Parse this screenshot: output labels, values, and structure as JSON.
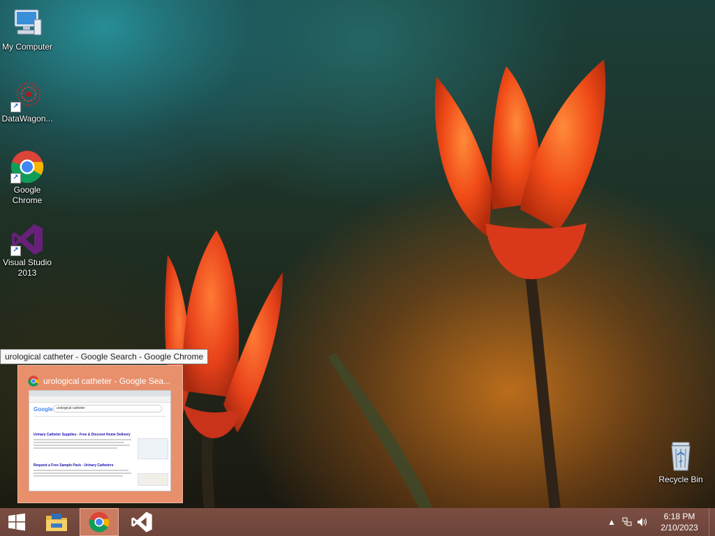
{
  "desktop_icons": [
    {
      "name": "my-computer",
      "label": "My Computer"
    },
    {
      "name": "datawagon",
      "label": "DataWagon..."
    },
    {
      "name": "google-chrome",
      "label": "Google Chrome"
    },
    {
      "name": "visual-studio",
      "label": "Visual Studio 2013"
    },
    {
      "name": "recycle-bin",
      "label": "Recycle Bin"
    }
  ],
  "tooltip": {
    "text": "urological catheter - Google Search - Google Chrome"
  },
  "thumbnail": {
    "title": "urological catheter - Google Sea...",
    "page_logo": "Google",
    "search_text": "urological catheter",
    "result_1_title": "Urinary Catheter Supplies - Free & Discreet Home Delivery",
    "result_2_title": "Request a Free Sample Pack - Urinary Catheters"
  },
  "taskbar": {
    "buttons": [
      {
        "name": "start",
        "icon": "windows-logo-icon"
      },
      {
        "name": "file-explorer",
        "icon": "folder-icon"
      },
      {
        "name": "google-chrome",
        "icon": "chrome-icon",
        "active": true
      },
      {
        "name": "visual-studio",
        "icon": "visual-studio-icon"
      }
    ],
    "tray_icons": [
      "chevron-up-icon",
      "network-icon",
      "volume-icon"
    ]
  },
  "clock": {
    "time": "6:18 PM",
    "date": "2/10/2023"
  },
  "colors": {
    "taskbar": "#6f4438",
    "thumbnail_bg": "#e8906c",
    "active_button": "#e88c6e",
    "visual_studio": "#68217a"
  }
}
